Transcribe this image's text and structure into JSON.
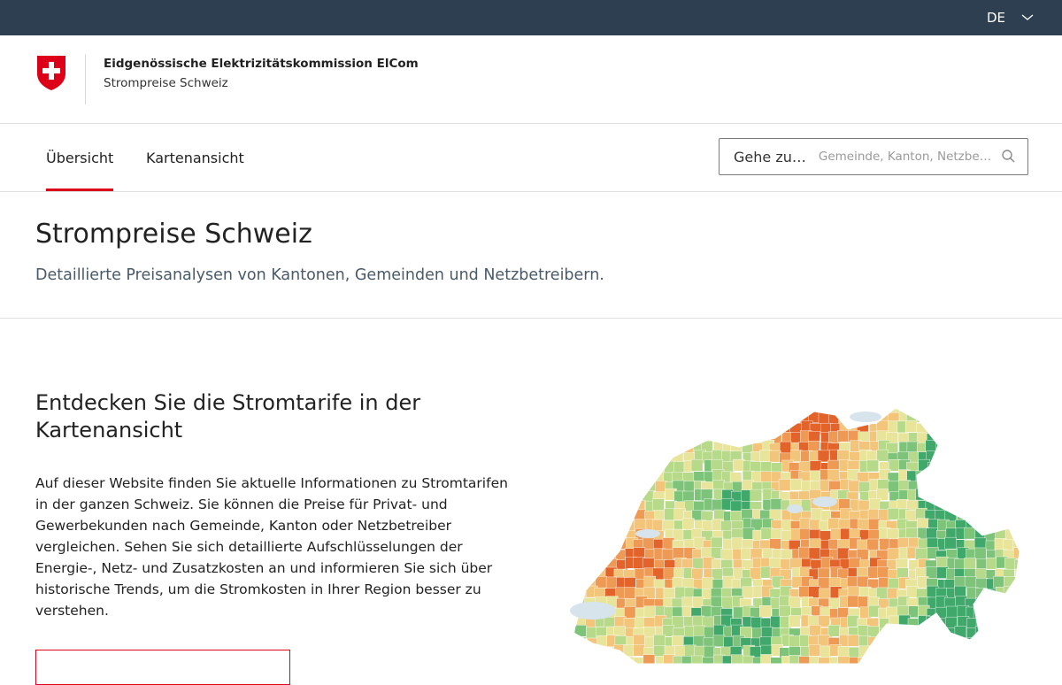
{
  "topbar": {
    "language": "DE",
    "background": "#2e3f52"
  },
  "header": {
    "organization": "Eidgenössische Elektrizitätskommission ElCom",
    "subtitle": "Strompreise Schweiz",
    "crest_icon": "swiss-crest-icon"
  },
  "nav": {
    "tabs": [
      {
        "label": "Übersicht",
        "active": true
      },
      {
        "label": "Kartenansicht",
        "active": false
      }
    ],
    "accent": "#dc0018"
  },
  "search": {
    "label": "Gehe zu…",
    "placeholder": "Gemeinde, Kanton, Netzbe…",
    "icon": "search-icon"
  },
  "hero": {
    "title": "Strompreise Schweiz",
    "lead": "Detaillierte Preisanalysen von Kantonen, Gemeinden und Netzbetreibern."
  },
  "teaser": {
    "title": "Entdecken Sie die Stromtarife in der Kartenansicht",
    "body": "Auf dieser Website finden Sie aktuelle Informationen zu Stromtarifen in der ganzen Schweiz. Sie können die Preise für Privat- und Gewerbekunden nach Gemeinde, Kanton oder Netzbetreiber vergleichen. Sehen Sie sich detaillierte Aufschlüsselungen der Energie-, Netz- und Zusatzkosten an und informieren Sie sich über historische Trends, um die Stromkosten in Ihrer Region besser zu verstehen."
  },
  "map": {
    "colors": [
      "#3fa86a",
      "#7dc47a",
      "#b7d98a",
      "#e8e59a",
      "#f2c57a",
      "#ee9a55",
      "#e3642a"
    ],
    "lakes": "#d7e4ec"
  }
}
